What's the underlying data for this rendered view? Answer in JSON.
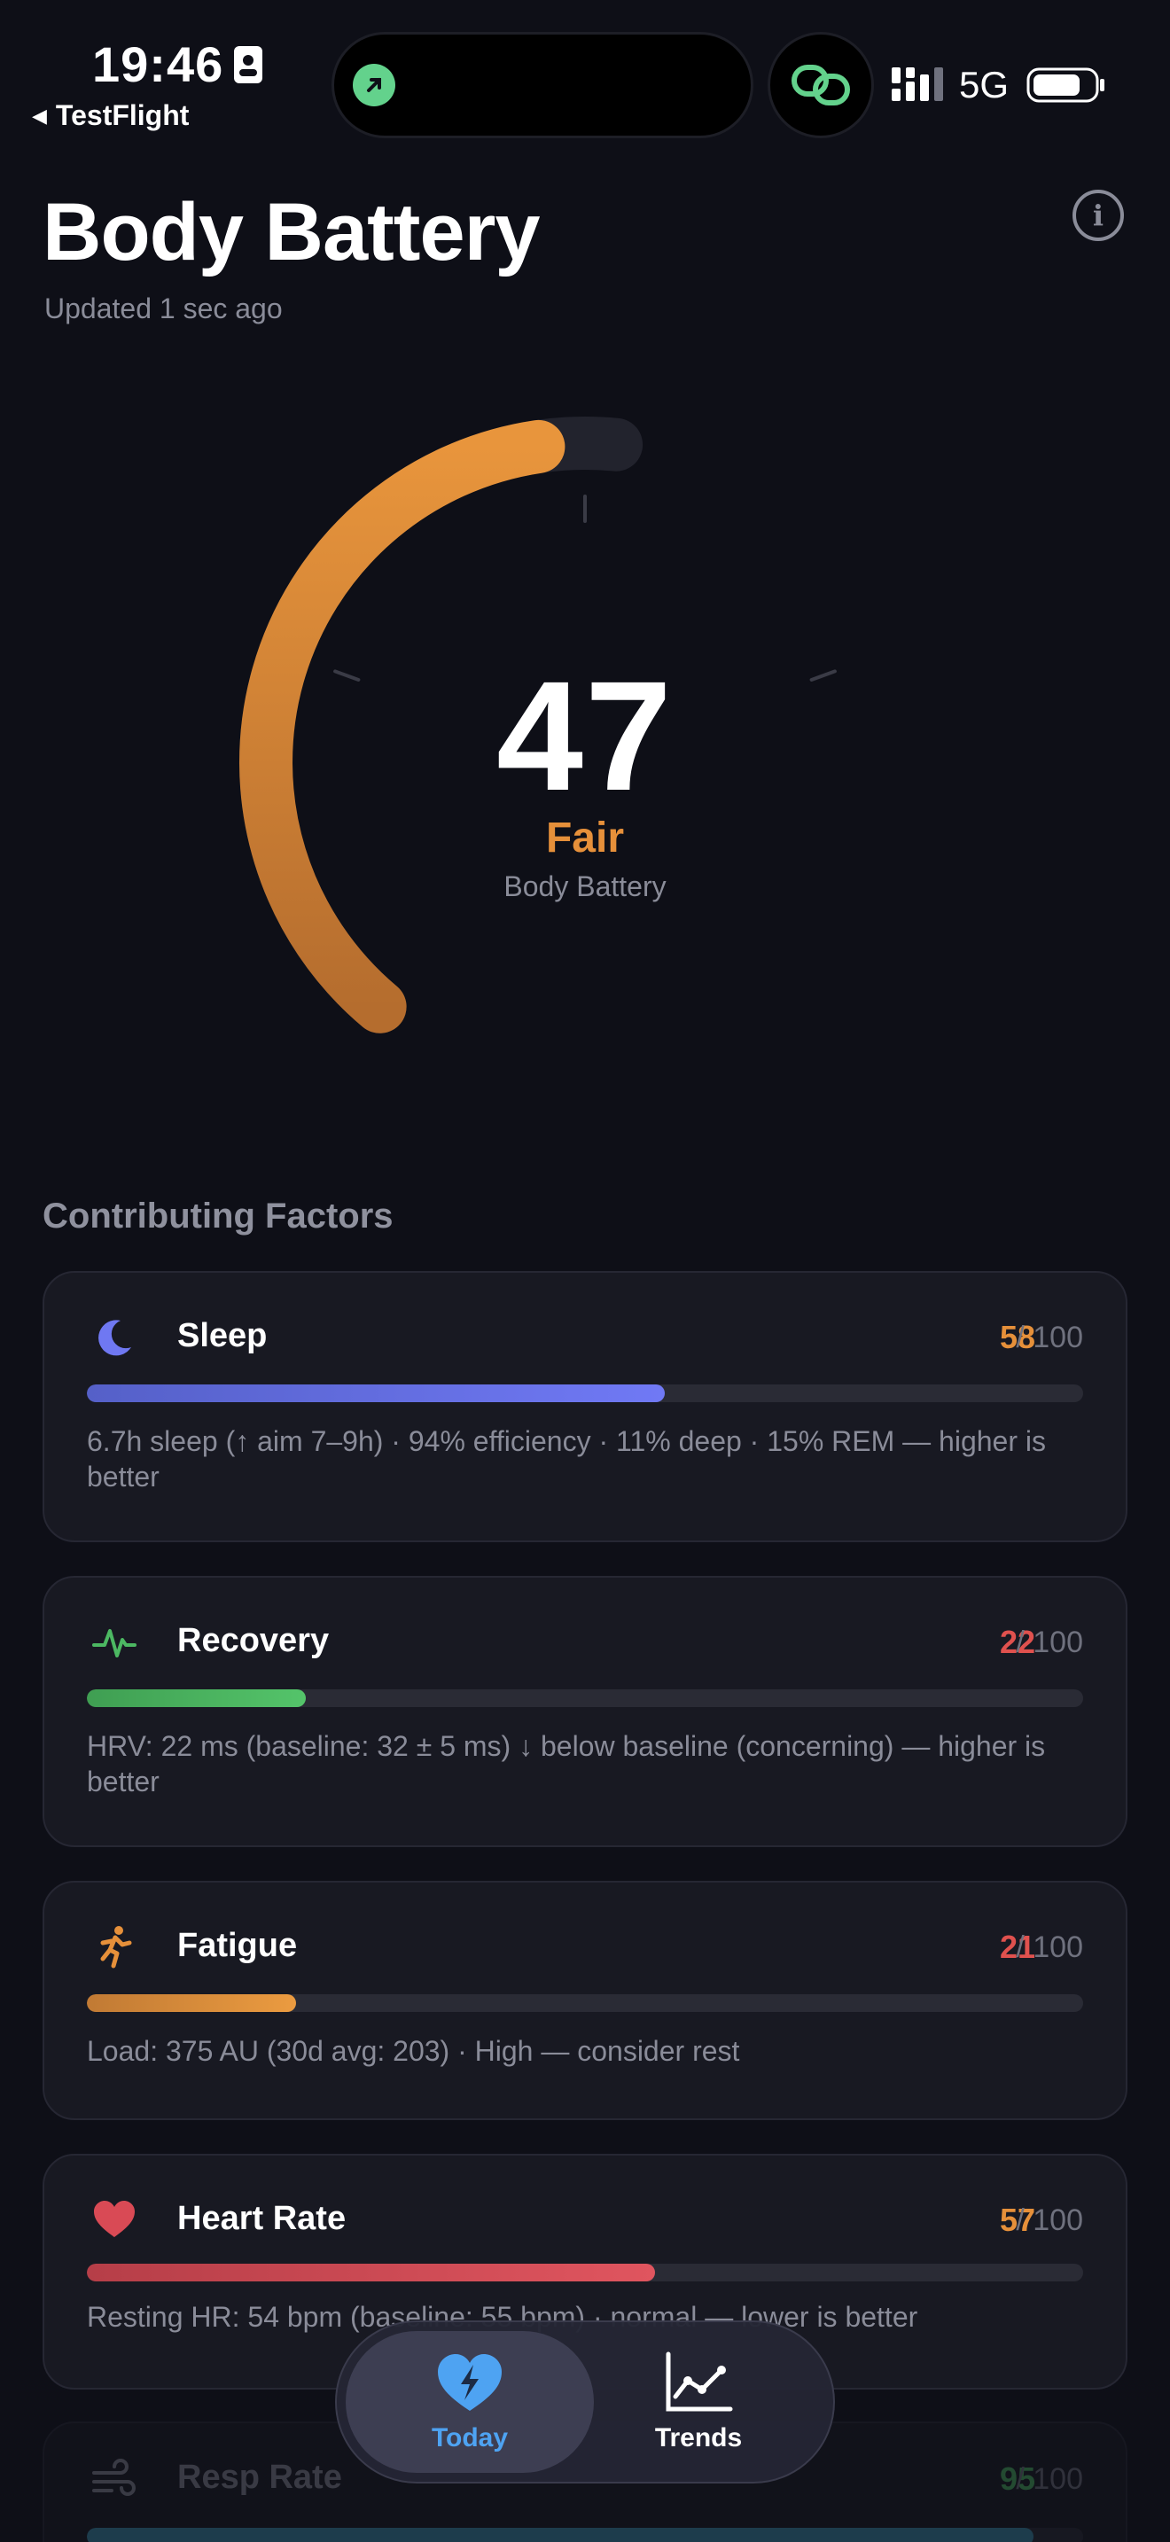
{
  "status_bar": {
    "time": "19:46",
    "back_label": "TestFlight",
    "network": "5G"
  },
  "header": {
    "title": "Body Battery",
    "updated": "Updated 1 sec ago"
  },
  "gauge": {
    "value": "47",
    "level": 47,
    "status": "Fair",
    "caption": "Body Battery",
    "color": "#e6903a"
  },
  "factors": {
    "title": "Contributing Factors",
    "items": [
      {
        "name": "Sleep",
        "score": "58",
        "max": "/ 100",
        "level": 58,
        "icon": "moon-icon",
        "color": "#6f78f2",
        "score_color": "#e6903a",
        "description": "6.7h sleep (↑ aim 7–9h) · 94% efficiency · 11% deep · 15% REM — higher is better"
      },
      {
        "name": "Recovery",
        "score": "22",
        "max": "/ 100",
        "level": 22,
        "icon": "heartbeat-icon",
        "color": "#4cb862",
        "score_color": "#e0514e",
        "description": "HRV: 22 ms (baseline: 32 ± 5 ms) ↓ below baseline (concerning) — higher is better"
      },
      {
        "name": "Fatigue",
        "score": "21",
        "max": "/ 100",
        "level": 21,
        "icon": "runner-icon",
        "color": "#e6903a",
        "score_color": "#e0514e",
        "description": "Load: 375 AU (30d avg: 203) · High — consider rest"
      },
      {
        "name": "Heart Rate",
        "score": "57",
        "max": "/ 100",
        "level": 57,
        "icon": "heart-icon",
        "color": "#d94a55",
        "score_color": "#e6903a",
        "description": "Resting HR: 54 bpm (baseline: 55 bpm) · normal — lower is better"
      },
      {
        "name": "Resp Rate",
        "score": "95",
        "max": "/ 100",
        "level": 95,
        "icon": "wind-icon",
        "color": "#3a8fb0",
        "score_color": "#4cb862",
        "description": ""
      }
    ]
  },
  "tabs": [
    {
      "label": "Today",
      "icon": "heart-bolt-icon",
      "active": true,
      "color": "#4ea3f2"
    },
    {
      "label": "Trends",
      "icon": "chart-line-icon",
      "active": false,
      "color": "#ffffff"
    }
  ]
}
